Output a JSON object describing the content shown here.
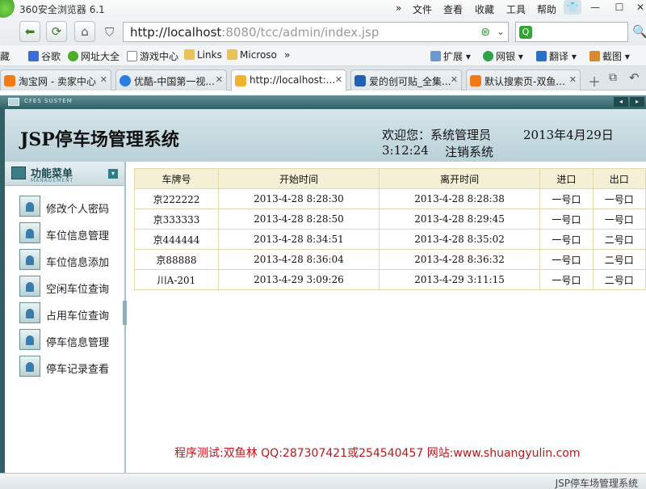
{
  "browser": {
    "title": "360安全浏览器 6.1",
    "menu": [
      "文件",
      "查看",
      "收藏",
      "工具",
      "帮助"
    ],
    "url_host": "http://localhost",
    "url_rest": ":8080/tcc/admin/index.jsp",
    "bookmarks": [
      "藏",
      "谷歌",
      "网址大全",
      "游戏中心",
      "Links",
      "Microso",
      "»"
    ],
    "bookmarks_right": [
      "扩展",
      "网银",
      "翻译",
      "截图"
    ],
    "tabs": [
      "淘宝网 - 卖家中心",
      "优酷-中国第一视...",
      "http://localhost:...",
      "爱的创可贴_全集...",
      "默认搜索页-双鱼..."
    ]
  },
  "app": {
    "strip_label": "CFES SUSTEM",
    "title": "JSP停车场管理系统",
    "welcome": "欢迎您：系统管理员",
    "date": "2013年4月29日",
    "time": "3:12:24",
    "logout": "注销系统"
  },
  "sidebar": {
    "title": "功能菜单",
    "subtitle": "MANAGEMENT",
    "items": [
      {
        "label": "修改个人密码"
      },
      {
        "label": "车位信息管理"
      },
      {
        "label": "车位信息添加"
      },
      {
        "label": "空闲车位查询"
      },
      {
        "label": "占用车位查询"
      },
      {
        "label": "停车信息管理"
      },
      {
        "label": "停车记录查看"
      }
    ]
  },
  "table": {
    "headers": [
      "车牌号",
      "开始时间",
      "离开时间",
      "进口",
      "出口"
    ],
    "rows": [
      [
        "京222222",
        "2013-4-28 8:28:30",
        "2013-4-28 8:28:38",
        "一号口",
        "一号口"
      ],
      [
        "京333333",
        "2013-4-28 8:28:50",
        "2013-4-28 8:29:45",
        "一号口",
        "一号口"
      ],
      [
        "京444444",
        "2013-4-28 8:34:51",
        "2013-4-28 8:35:02",
        "一号口",
        "二号口"
      ],
      [
        "京88888",
        "2013-4-28 8:36:04",
        "2013-4-28 8:36:32",
        "一号口",
        "二号口"
      ],
      [
        "川A-201",
        "2013-4-29 3:09:26",
        "2013-4-29 3:11:15",
        "一号口",
        "二号口"
      ]
    ]
  },
  "footer": {
    "credit": "程序测试:双鱼林 QQ:287307421或254540457 网站:www.shuangyulin.com",
    "status": "JSP停车场管理系统"
  },
  "colors": {
    "accent": "#2f6066",
    "credit": "#c0141a",
    "header_bg": "#b9d0d8",
    "table_head": "#f4f0d6"
  }
}
